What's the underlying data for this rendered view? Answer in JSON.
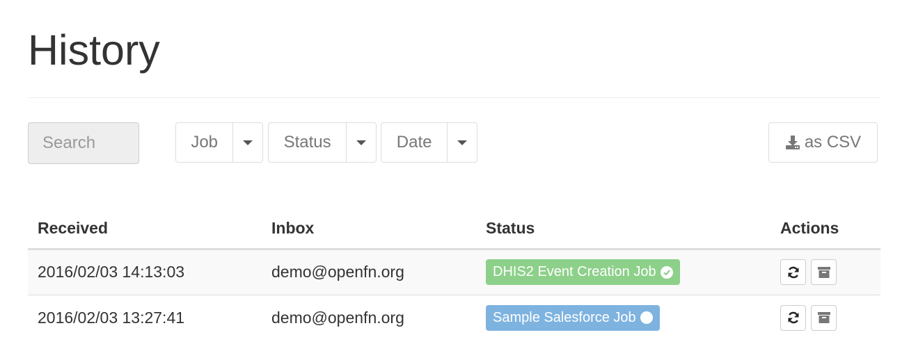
{
  "page": {
    "title": "History"
  },
  "filters": {
    "search_placeholder": "Search",
    "job_label": "Job",
    "status_label": "Status",
    "date_label": "Date",
    "csv_label": "as CSV"
  },
  "table": {
    "headers": {
      "received": "Received",
      "inbox": "Inbox",
      "status": "Status",
      "actions": "Actions"
    },
    "rows": [
      {
        "received": "2016/02/03 14:13:03",
        "inbox": "demo@openfn.org",
        "status_label": "DHIS2 Event Creation Job",
        "status_color": "#8dd08a",
        "status_icon": "check-circle-icon",
        "actions": [
          "refresh-icon",
          "archive-icon"
        ]
      },
      {
        "received": "2016/02/03 13:27:41",
        "inbox": "demo@openfn.org",
        "status_label": "Sample Salesforce Job",
        "status_color": "#7eb3e0",
        "status_icon": "circle-icon",
        "actions": [
          "refresh-icon",
          "archive-icon"
        ]
      }
    ]
  },
  "colors": {
    "success": "#8dd08a",
    "info": "#7eb3e0",
    "text": "#333333",
    "muted": "#777777"
  }
}
